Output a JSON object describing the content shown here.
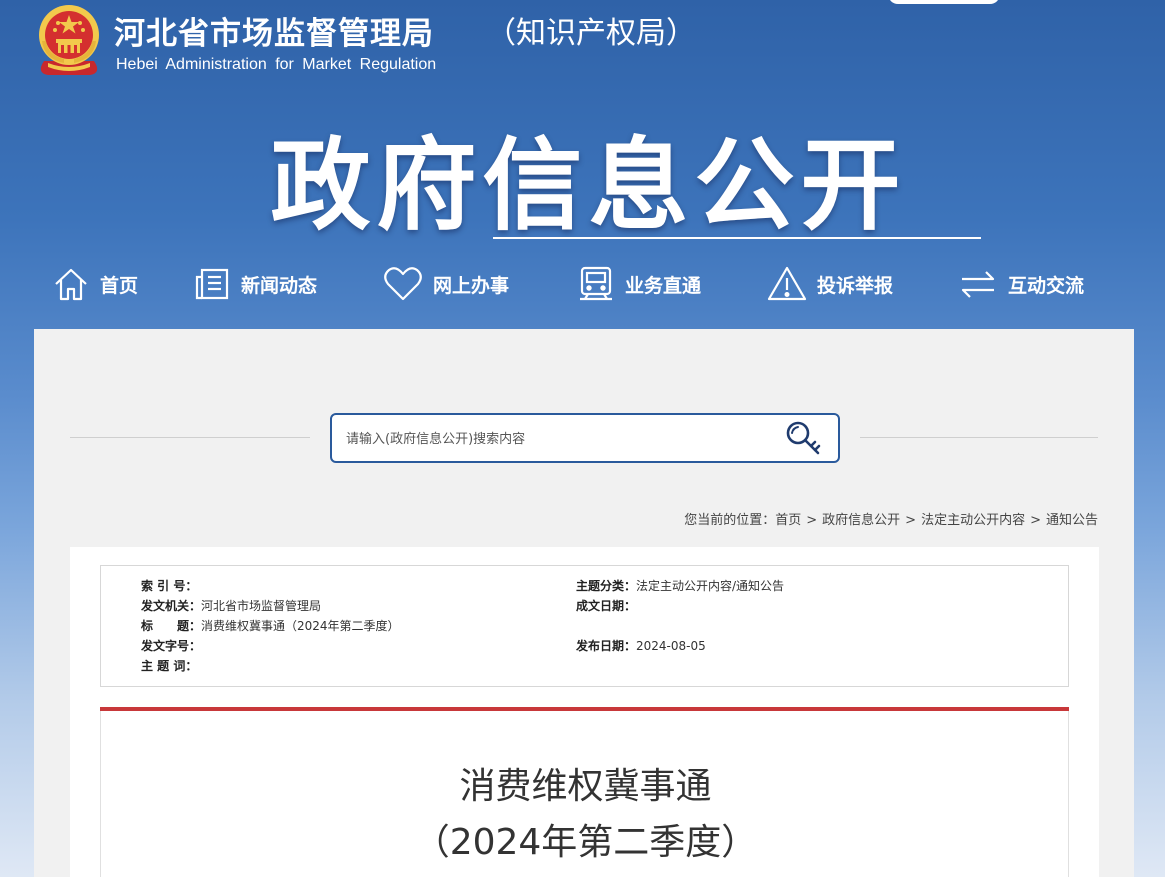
{
  "header": {
    "site_name": "河北省市场监督管理局",
    "site_sub": "（知识产权局）",
    "site_name_en": "Hebei  Administration  for  Market  Regulation",
    "section_title": "政府信息公开"
  },
  "nav": [
    {
      "label": "首页",
      "icon": "home-icon"
    },
    {
      "label": "新闻动态",
      "icon": "news-icon"
    },
    {
      "label": "网上办事",
      "icon": "heart-icon"
    },
    {
      "label": "业务直通",
      "icon": "train-icon"
    },
    {
      "label": "投诉举报",
      "icon": "warning-icon"
    },
    {
      "label": "互动交流",
      "icon": "exchange-icon"
    }
  ],
  "search": {
    "placeholder": "请输入(政府信息公开)搜索内容",
    "icon": "key-search-icon"
  },
  "breadcrumb": {
    "prefix": "您当前的位置：",
    "items": [
      "首页",
      "政府信息公开",
      "法定主动公开内容",
      "通知公告"
    ],
    "separator": ">"
  },
  "meta": {
    "index_label": "索 引 号：",
    "index_value": "",
    "category_label": "主题分类：",
    "category_value": "法定主动公开内容/通知公告",
    "issuer_label": "发文机关：",
    "issuer_value": "河北省市场监督管理局",
    "created_label": "成文日期：",
    "created_value": "",
    "title_label": "标　　题：",
    "title_value": "消费维权冀事通（2024年第二季度）",
    "docno_label": "发文字号：",
    "docno_value": "",
    "published_label": "发布日期：",
    "published_value": "2024-08-05",
    "keywords_label": "主 题 词：",
    "keywords_value": ""
  },
  "article": {
    "title_line1": "消费维权冀事通",
    "title_line2": "（2024年第二季度）"
  },
  "colors": {
    "header_blue": "#2f62a8",
    "search_border": "#2a5a9c",
    "accent_red": "#c8383a"
  }
}
